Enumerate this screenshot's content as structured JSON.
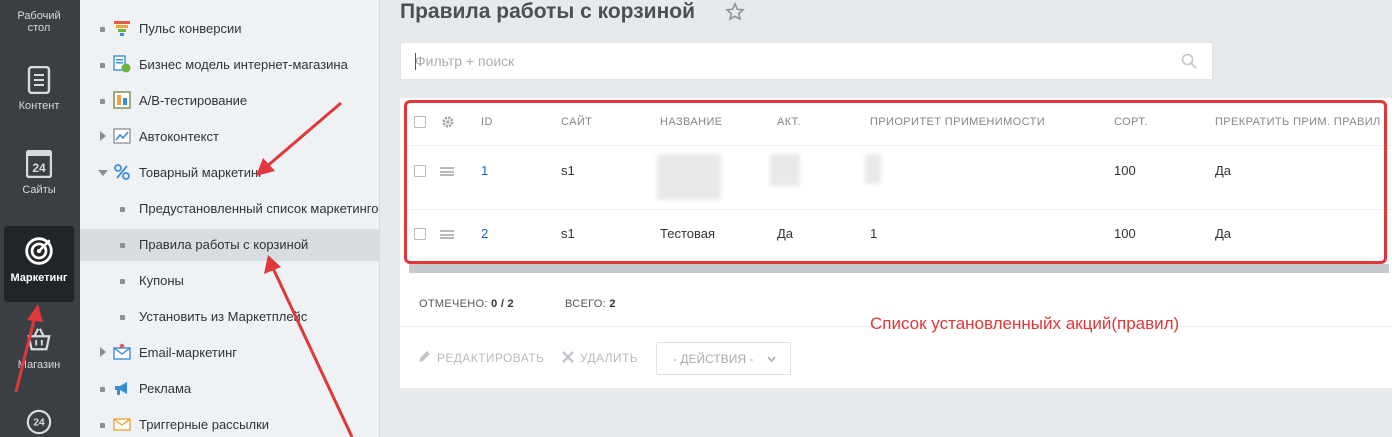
{
  "appbar": {
    "items": [
      {
        "label_line1": "Рабочий",
        "label_line2": "стол",
        "icon": "desktop-icon"
      },
      {
        "label": "Контент",
        "icon": "document-icon"
      },
      {
        "label": "Сайты",
        "icon": "calendar-24-icon",
        "badge": "24"
      },
      {
        "label": "Маркетинг",
        "icon": "target-icon"
      },
      {
        "label": "Магазин",
        "icon": "basket-icon"
      },
      {
        "icon": "bitrix24-icon",
        "badge": "24"
      }
    ]
  },
  "sidebar": {
    "items": [
      {
        "label": "Пульс конверсии",
        "icon": "funnel-icon"
      },
      {
        "label": "Бизнес модель интернет-магазина",
        "icon": "business-model-icon"
      },
      {
        "label": "А/В-тестирование",
        "icon": "ab-test-icon"
      },
      {
        "label": "Автоконтекст",
        "icon": "chart-icon"
      },
      {
        "label": "Товарный маркетинг",
        "icon": "percent-icon"
      },
      {
        "label": "Предустановленный список маркетинго"
      },
      {
        "label": "Правила работы с корзиной"
      },
      {
        "label": "Купоны"
      },
      {
        "label": "Установить из Маркетплейс"
      },
      {
        "label": "Email-маркетинг",
        "icon": "email-marketing-icon"
      },
      {
        "label": "Реклама",
        "icon": "megaphone-icon"
      },
      {
        "label": "Триггерные рассылки",
        "icon": "envelope-icon"
      }
    ]
  },
  "main": {
    "title": "Правила работы с корзиной",
    "search_placeholder": "Фильтр + поиск",
    "columns": [
      "ID",
      "САЙТ",
      "НАЗВАНИЕ",
      "АКТ.",
      "ПРИОРИТЕТ ПРИМЕНИМОСТИ",
      "СОРТ.",
      "ПРЕКРАТИТЬ ПРИМ. ПРАВИЛ"
    ],
    "rows": [
      {
        "id": "1",
        "site": "s1",
        "name": "",
        "active": "",
        "priority": "",
        "sort": "100",
        "stop": "Да"
      },
      {
        "id": "2",
        "site": "s1",
        "name": "Тестовая",
        "active": "Да",
        "priority": "1",
        "sort": "100",
        "stop": "Да"
      }
    ],
    "footer": {
      "selected_label": "ОТМЕЧЕНО:",
      "selected_value": "0 / 2",
      "total_label": "ВСЕГО:",
      "total_value": "2"
    },
    "actions": {
      "edit": "РЕДАКТИРОВАТЬ",
      "delete": "УДАЛИТЬ",
      "select": "- ДЕЙСТВИЯ -"
    },
    "annotation": "Список установленныйх акций(правил)"
  },
  "colors": {
    "accent_red": "#e0383a",
    "link_blue": "#2067b0",
    "appbar_bg": "#3b3f44"
  }
}
